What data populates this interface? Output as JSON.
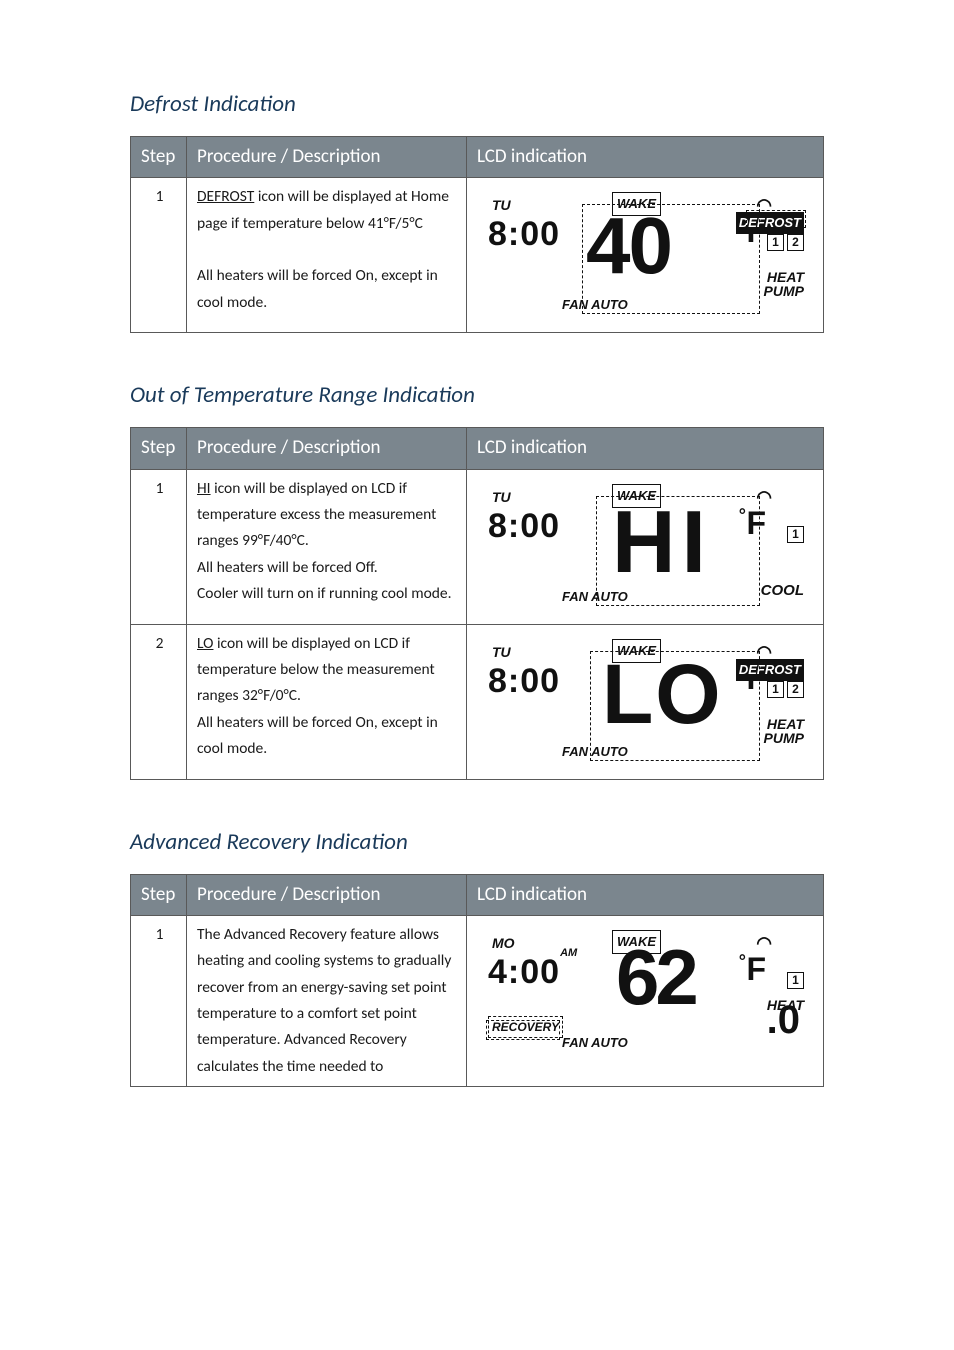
{
  "sections": {
    "defrost": {
      "title": "Defrost Indication",
      "headers": {
        "step": "Step",
        "proc": "Procedure / Description",
        "lcd": "LCD indication"
      },
      "row": {
        "step": "1",
        "proc_l1a": "DEFROST",
        "proc_l1b": " icon will be displayed at Home page if temperature below 41°F/5°C",
        "proc_l3": "All heaters will be forced On, except in cool mode.",
        "lcd": {
          "day": "TU",
          "wake": "WAKE",
          "clock": "8:00",
          "deg": "°",
          "degF": "F",
          "defrost": "DEFROST",
          "box1": "1",
          "box2": "2",
          "heat": "HEAT",
          "pump": "PUMP",
          "fan": "FAN AUTO",
          "big": "40"
        }
      }
    },
    "range": {
      "title": "Out of Temperature Range Indication",
      "headers": {
        "step": "Step",
        "proc": "Procedure / Description",
        "lcd": "LCD indication"
      },
      "row1": {
        "step": "1",
        "p1a": "HI",
        "p1b": " icon will be displayed on LCD if temperature excess the measurement ranges 99°F/40°C.",
        "p2": "All heaters will be forced Off.",
        "p3": "Cooler will turn on if running cool mode.",
        "lcd": {
          "day": "TU",
          "wake": "WAKE",
          "clock": "8:00",
          "deg": "°",
          "degF": "F",
          "box1": "1",
          "cool": "COOL",
          "fan": "FAN AUTO",
          "big": "HI"
        }
      },
      "row2": {
        "step": "2",
        "p1a": "LO",
        "p1b": " icon will be displayed on LCD if temperature below the measurement ranges 32°F/0°C.",
        "p2": "All heaters will be forced On, except in cool mode.",
        "lcd": {
          "day": "TU",
          "wake": "WAKE",
          "clock": "8:00",
          "deg": "°",
          "degF": "F",
          "defrost": "DEFROST",
          "box1": "1",
          "box2": "2",
          "heat": "HEAT",
          "pump": "PUMP",
          "fan": "FAN AUTO",
          "big": "LO"
        }
      }
    },
    "recovery": {
      "title": "Advanced Recovery Indication",
      "headers": {
        "step": "Step",
        "proc": "Procedure / Description",
        "lcd": "LCD indication"
      },
      "row": {
        "step": "1",
        "p": "The Advanced Recovery feature allows heating and cooling systems to gradually recover from an energy-saving set point temperature to a comfort set point temperature. Advanced Recovery calculates the time needed to",
        "lcd": {
          "day": "MO",
          "wake": "WAKE",
          "clock": "4:00",
          "am": "AM",
          "deg": "°",
          "degF": "F",
          "box1": "1",
          "heat": "HEAT",
          "recov": "RECOVERY",
          "fan": "FAN AUTO",
          "big": "62",
          "decimal": ".0"
        }
      }
    }
  }
}
